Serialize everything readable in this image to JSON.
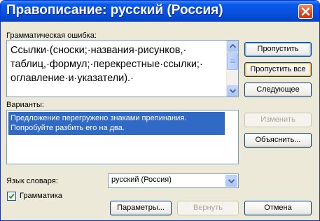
{
  "window": {
    "title": "Правописание: русский (Россия)"
  },
  "grammar": {
    "label": "Грамматическая ошибка:",
    "lines": [
      "Ссылки·(сноски;·названия·рисунков,·",
      "таблиц,·формул;·перекрестные·ссылки;·",
      "оглавление·и·указатели).·"
    ]
  },
  "buttons": {
    "skip": "Пропустить",
    "skip_all": "Пропустить все",
    "next": "Следующее",
    "change": "Изменить",
    "explain": "Объяснить...",
    "options": "Параметры...",
    "undo": "Вернуть",
    "cancel": "Отмена"
  },
  "suggestions": {
    "label": "Варианты:",
    "items": [
      {
        "lines": [
          "Предложение перегружено знаками препинания.",
          "Попробуйте разбить его на два."
        ]
      }
    ]
  },
  "language": {
    "label": "Язык словаря:",
    "value": "русский (Россия)"
  },
  "grammar_check": {
    "label": "Грамматика",
    "checked": true
  },
  "icons": {
    "close": "close-icon",
    "scroll_up": "arrow-up-icon",
    "scroll_down": "arrow-down-icon",
    "dropdown": "chevron-down-icon",
    "check": "checkmark-icon"
  },
  "colors": {
    "titlebar": "#0a5ae8",
    "selection": "#316ac5",
    "dialog_bg": "#ece9d8",
    "close_button": "#d8471f"
  }
}
